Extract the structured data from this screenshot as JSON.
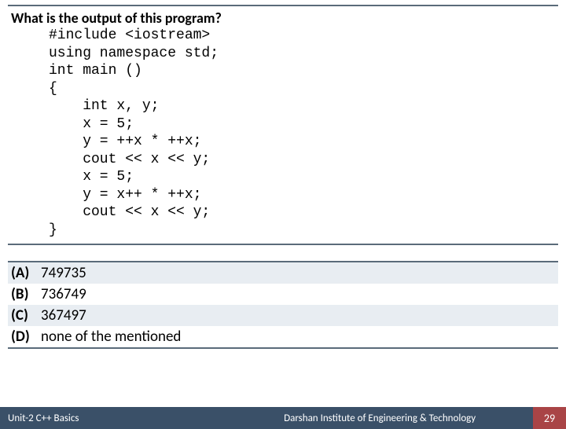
{
  "question": "What is the output of this program?",
  "code_lines": [
    "#include <iostream>",
    "using namespace std;",
    "int main ()",
    "{",
    "    int x, y;",
    "    x = 5;",
    "    y = ++x * ++x;",
    "    cout << x << y;",
    "    x = 5;",
    "    y = x++ * ++x;",
    "    cout << x << y;",
    "}"
  ],
  "options": [
    {
      "label": "(A)",
      "text": "749735"
    },
    {
      "label": "(B)",
      "text": "736749"
    },
    {
      "label": "(C)",
      "text": "367497"
    },
    {
      "label": "(D)",
      "text": "none of the mentioned"
    }
  ],
  "footer": {
    "left": "Unit-2 C++ Basics",
    "center": "Darshan Institute of Engineering & Technology",
    "page": "29"
  }
}
